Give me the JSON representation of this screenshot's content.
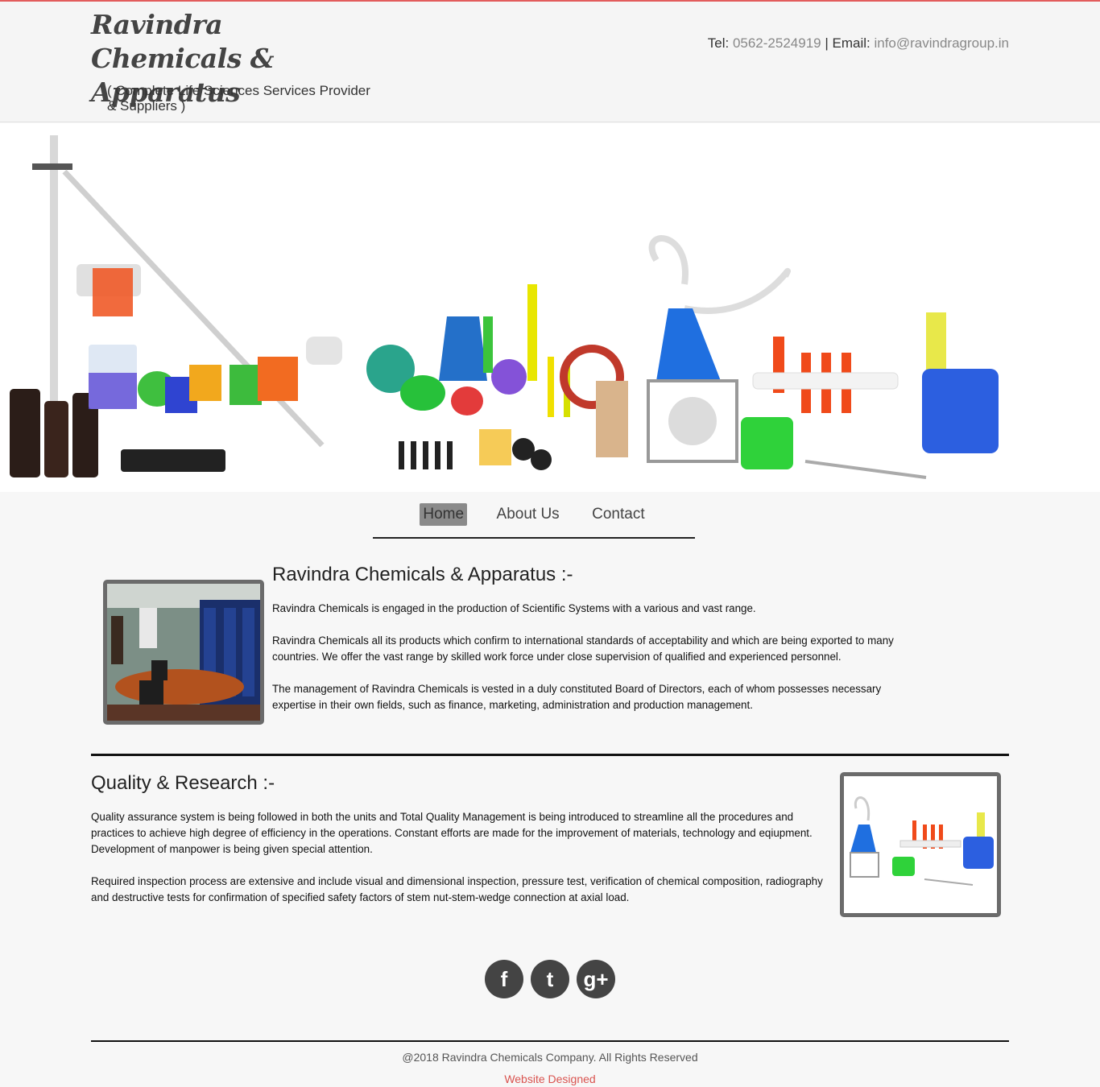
{
  "header": {
    "brand": "Ravindra Chemicals & Apparatus",
    "tagline": "( Complete Life Sciences Services Provider & Suppliers )",
    "tel_label": "Tel:",
    "tel_value": "0562-2524919",
    "separator": "|",
    "email_label": "Email:",
    "email_value": "info@ravindragroup.in"
  },
  "nav": {
    "items": [
      {
        "label": "Home",
        "active": true
      },
      {
        "label": "About Us",
        "active": false
      },
      {
        "label": "Contact",
        "active": false
      }
    ]
  },
  "about": {
    "title": "Ravindra Chemicals & Apparatus :-",
    "paragraphs": [
      "Ravindra Chemicals is engaged in the production of Scientific Systems with a various and vast range.",
      "Ravindra Chemicals all its products which confirm to international standards of acceptability and which are being exported to many countries. We offer the vast range by skilled work force under close supervision of qualified and experienced personnel.",
      "The management of Ravindra Chemicals is vested in a duly constituted Board of Directors, each of whom possesses necessary expertise in their own fields, such as finance, marketing, administration and production management."
    ]
  },
  "quality": {
    "title": "Quality & Research :-",
    "paragraphs": [
      "Quality assurance system is being followed in both the units and Total Quality Management is being introduced to streamline all the procedures and practices to achieve high degree of efficiency in the operations. Constant efforts are made for the improvement of materials, technology and eqiupment. Development of manpower is being given special attention.",
      "Required inspection process are extensive and include visual and dimensional inspection, pressure test, verification of chemical composition, radiography and destructive tests for confirmation of specified safety factors of stem nut-stem-wedge connection at axial load."
    ]
  },
  "social": {
    "facebook": "f",
    "twitter": "t",
    "googleplus": "g+"
  },
  "footer": {
    "copyright": "@2018 Ravindra Chemicals Company. All Rights Reserved",
    "designed": "Website Designed"
  },
  "colors": {
    "accent_red": "#e25c5c",
    "frame_gray": "#6b6b6b",
    "social_bg": "#444444"
  }
}
